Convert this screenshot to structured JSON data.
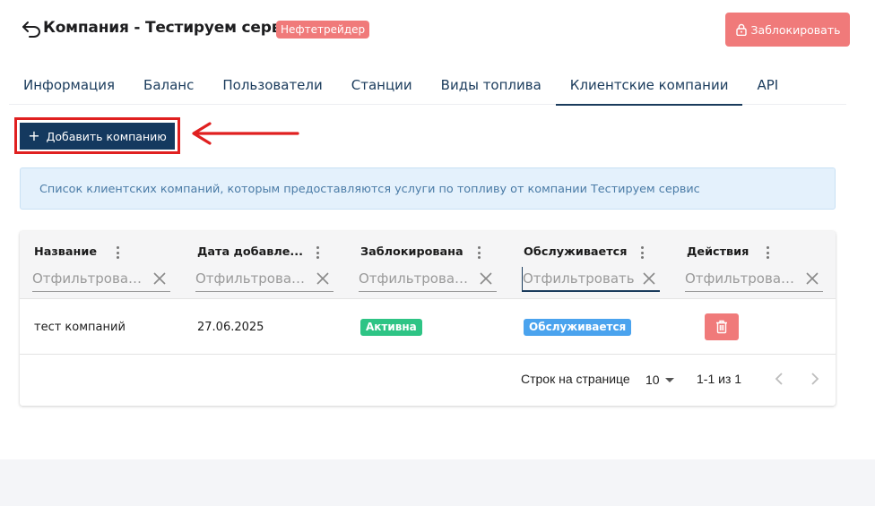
{
  "header": {
    "title": "Компания - Тестируем сервис",
    "badge": "Нефтетрейдер",
    "block_button": "Заблокировать"
  },
  "tabs": [
    {
      "label": "Информация",
      "active": false
    },
    {
      "label": "Баланс",
      "active": false
    },
    {
      "label": "Пользователи",
      "active": false
    },
    {
      "label": "Станции",
      "active": false
    },
    {
      "label": "Виды топлива",
      "active": false
    },
    {
      "label": "Клиентские компании",
      "active": true
    },
    {
      "label": "API",
      "active": false
    }
  ],
  "actions": {
    "add_company": "Добавить компанию"
  },
  "info_alert": "Список клиентских компаний, которым предоставляются услуги по топливу от компании Тестируем сервис",
  "table": {
    "filter_placeholders": [
      "Отфильтрова…",
      "Отфильтрова…",
      "Отфильтрова…",
      "Отфильтровать",
      "Отфильтрова…"
    ],
    "columns": [
      "Название",
      "Дата добавле...",
      "Заблокирована",
      "Обслуживается",
      "Действия"
    ],
    "rows": [
      {
        "name": "тест компаний",
        "date_added": "27.06.2025",
        "blocked_status": "Активна",
        "service_status": "Обслуживается"
      }
    ],
    "pagination": {
      "rows_per_page_label": "Строк на странице",
      "rows_per_page": "10",
      "range": "1-1 из 1"
    }
  },
  "colors": {
    "primary": "#14395f",
    "danger": "#f07a7a",
    "success": "#2ec485",
    "info": "#4aa3ee",
    "annotation": "#e02020"
  }
}
